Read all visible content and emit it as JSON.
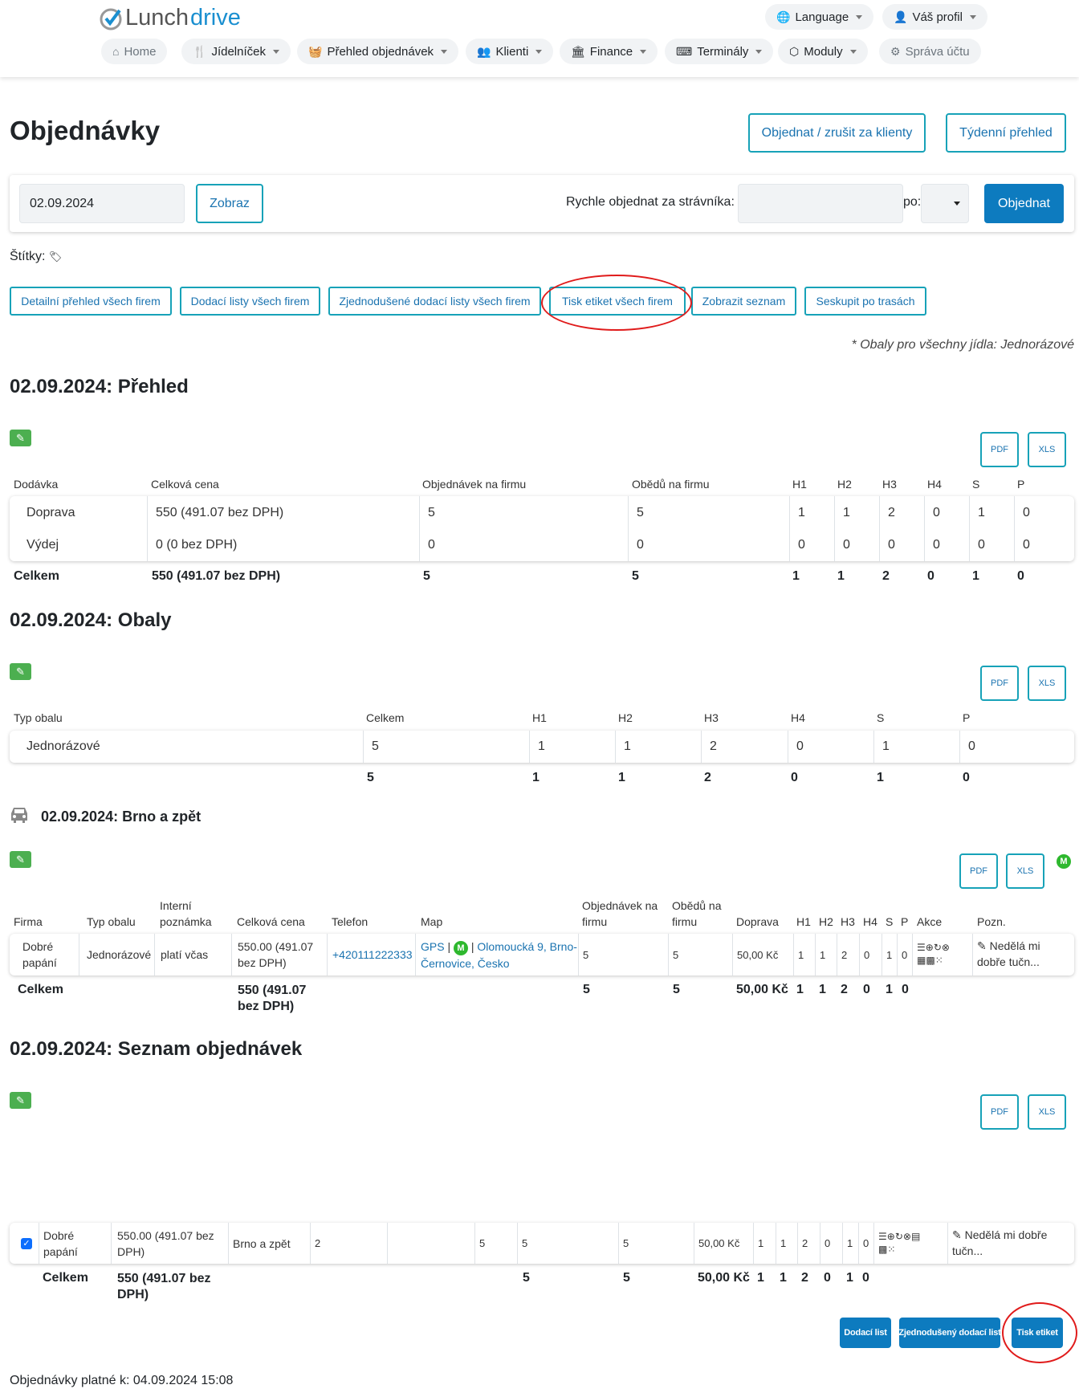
{
  "brand": {
    "part1": "Lunch",
    "part2": "drive"
  },
  "topnav": {
    "language": "Language",
    "profile": "Váš profil"
  },
  "nav": [
    "Home",
    "Jídelníček",
    "Přehled objednávek",
    "Klienti",
    "Finance",
    "Terminály",
    "Moduly",
    "Správa účtu"
  ],
  "page": {
    "title": "Objednávky",
    "order_cancel_label": "Objednat / zrušit za klienty",
    "weekly_label": "Týdenní přehled"
  },
  "filter": {
    "date": "02.09.2024",
    "show_label": "Zobraz",
    "quick_label": "Rychle objednat za strávníka:",
    "po_label": "po:",
    "order_label": "Objednat"
  },
  "tags_label": "Štítky:",
  "buttons": [
    "Detailní přehled všech firem",
    "Dodací listy všech firem",
    "Zjednodušené dodací listy všech firem",
    "Tisk etiket všech firem",
    "Zobrazit seznam",
    "Seskupit po trasách"
  ],
  "packaging_note": "* Obaly pro všechny jídla: Jednorázové",
  "pdf": "PDF",
  "xls": "XLS",
  "overview": {
    "title": "02.09.2024: Přehled",
    "headers": [
      "Dodávka",
      "Celková cena",
      "Objednávek na firmu",
      "Obědů na firmu",
      "H1",
      "H2",
      "H3",
      "H4",
      "S",
      "P"
    ],
    "rows": [
      [
        "Doprava",
        "550 (491.07 bez DPH)",
        "5",
        "5",
        "1",
        "1",
        "2",
        "0",
        "1",
        "0"
      ],
      [
        "Výdej",
        "0 (0 bez DPH)",
        "0",
        "0",
        "0",
        "0",
        "0",
        "0",
        "0",
        "0"
      ]
    ],
    "total": [
      "Celkem",
      "550 (491.07 bez DPH)",
      "5",
      "5",
      "1",
      "1",
      "2",
      "0",
      "1",
      "0"
    ]
  },
  "packaging": {
    "title": "02.09.2024: Obaly",
    "headers": [
      "Typ obalu",
      "Celkem",
      "H1",
      "H2",
      "H3",
      "H4",
      "S",
      "P"
    ],
    "row": [
      "Jednorázové",
      "5",
      "1",
      "1",
      "2",
      "0",
      "1",
      "0"
    ],
    "total": [
      "5",
      "1",
      "1",
      "2",
      "0",
      "1",
      "0"
    ]
  },
  "route": {
    "title": "02.09.2024: Brno a zpět",
    "headers": [
      "Firma",
      "Typ obalu",
      "Interní poznámka",
      "Celková cena",
      "Telefon",
      "Map",
      "Objednávek na firmu",
      "Obědů na firmu",
      "Doprava",
      "H1",
      "H2",
      "H3",
      "H4",
      "S",
      "P",
      "Akce",
      "Pozn."
    ],
    "row": {
      "firma": "Dobré papání",
      "typ": "Jednorázové",
      "poznamka": "platí včas",
      "cena": "550.00 (491.07 bez DPH)",
      "telefon": "+420111222333",
      "gps": "GPS",
      "sep": "|",
      "address": "Olomoucká 9, Brno-Černovice, Česko",
      "objednavek": "5",
      "obedu": "5",
      "doprava": "50,00 Kč",
      "h1": "1",
      "h2": "1",
      "h3": "2",
      "h4": "0",
      "s": "1",
      "p": "0",
      "note": "Nedělá mi dobře tučn..."
    },
    "total": {
      "label": "Celkem",
      "cena": "550 (491.07 bez DPH)",
      "objednavek": "5",
      "obedu": "5",
      "doprava": "50,00 Kč",
      "h1": "1",
      "h2": "1",
      "h3": "2",
      "h4": "0",
      "s": "1",
      "p": "0"
    }
  },
  "orders": {
    "title": "02.09.2024: Seznam objednávek",
    "row": {
      "firma": "Dobré papání",
      "cena": "550.00 (491.07 bez DPH)",
      "trasa": "Brno a zpět",
      "c1": "2",
      "c2": "5",
      "c3": "5",
      "c4": "5",
      "doprava": "50,00 Kč",
      "h1": "1",
      "h2": "1",
      "h3": "2",
      "h4": "0",
      "s": "1",
      "p": "0",
      "note": "Nedělá mi dobře tučn..."
    },
    "total": {
      "label": "Celkem",
      "cena": "550 (491.07 bez DPH)",
      "c1": "5",
      "c2": "5",
      "doprava": "50,00 Kč",
      "h1": "1",
      "h2": "1",
      "h3": "2",
      "h4": "0",
      "s": "1",
      "p": "0"
    }
  },
  "bottom_buttons": [
    "Dodací list",
    "Zjednodušený dodací list",
    "Tisk etiket"
  ],
  "valid_label": "Objednávky platné k: 04.09.2024 15:08",
  "map_badge": "M",
  "colors": {
    "primary": "#0d7bbf",
    "outline": "#17a2b8",
    "green": "#4caf50",
    "highlight": "#e01b1b"
  }
}
